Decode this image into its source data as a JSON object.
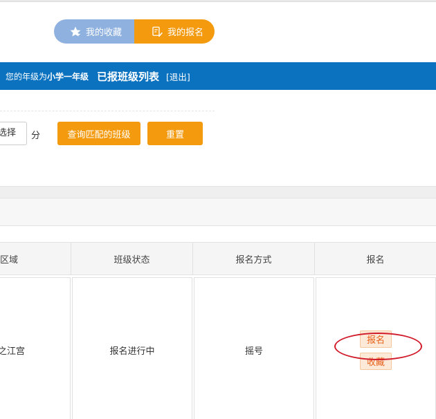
{
  "tabs": {
    "favorites_label": "我的收藏",
    "my_registrations_label": "我的报名"
  },
  "header": {
    "grade_prefix": "您的年级为",
    "grade": "小学一年级",
    "title": "已报班级列表",
    "logout": "[退出]"
  },
  "filters": {
    "select_text": "选择",
    "unit": "分",
    "query_button": "查询匹配的班级",
    "reset_button": "重置"
  },
  "table": {
    "headers": [
      "区域",
      "班级状态",
      "报名方式",
      "报名"
    ],
    "rows": [
      {
        "area": "之江宫",
        "status": "报名进行中",
        "method": "摇号",
        "register_action": "报名",
        "favorite_action": "收藏"
      }
    ]
  },
  "colors": {
    "accent_orange": "#f39a0f",
    "header_blue": "#0b72c0",
    "tab_blue": "#8fb1e0",
    "tag_text": "#e8601a",
    "annotation_red": "#d11a2a"
  }
}
